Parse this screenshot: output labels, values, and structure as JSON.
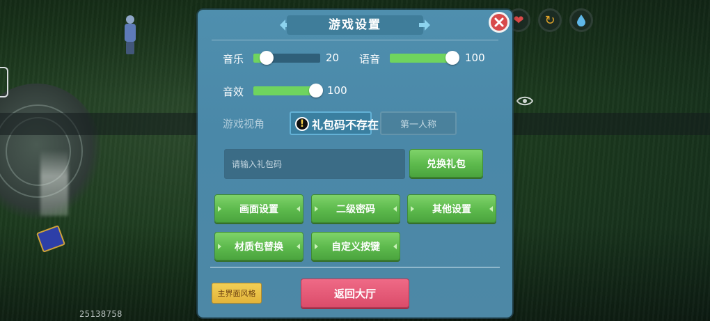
{
  "dialog": {
    "title": "游戏设置"
  },
  "audio": {
    "music_label": "音乐",
    "music_value": "20",
    "music_level": 0.2,
    "voice_label": "语音",
    "voice_value": "100",
    "voice_level": 1.0,
    "sfx_label": "音效",
    "sfx_value": "100",
    "sfx_level": 1.0
  },
  "view": {
    "label": "游戏视角",
    "second_option": "第一人称"
  },
  "toast": {
    "icon": "warning-icon",
    "text": "礼包码不存在"
  },
  "gift": {
    "placeholder": "请输入礼包码",
    "redeem_label": "兑换礼包"
  },
  "buttons": {
    "graphics": "画面设置",
    "secondary_password": "二级密码",
    "other_settings": "其他设置",
    "texture_pack": "材质包替换",
    "custom_keys": "自定义按键",
    "main_style": "主界面风格",
    "return_lobby": "返回大厅"
  },
  "hud": {
    "icons": [
      "heart-icon",
      "swap-icon",
      "drop-icon",
      "eye-icon"
    ]
  },
  "footer": {
    "player_id": "25138758"
  },
  "colors": {
    "panel": "#4f8fae",
    "slider_fill": "#6fd45e",
    "green_button": "#5cb94c",
    "red_button": "#db4c6a",
    "yellow_button": "#e3b43a",
    "close_button": "#d84a4a"
  }
}
